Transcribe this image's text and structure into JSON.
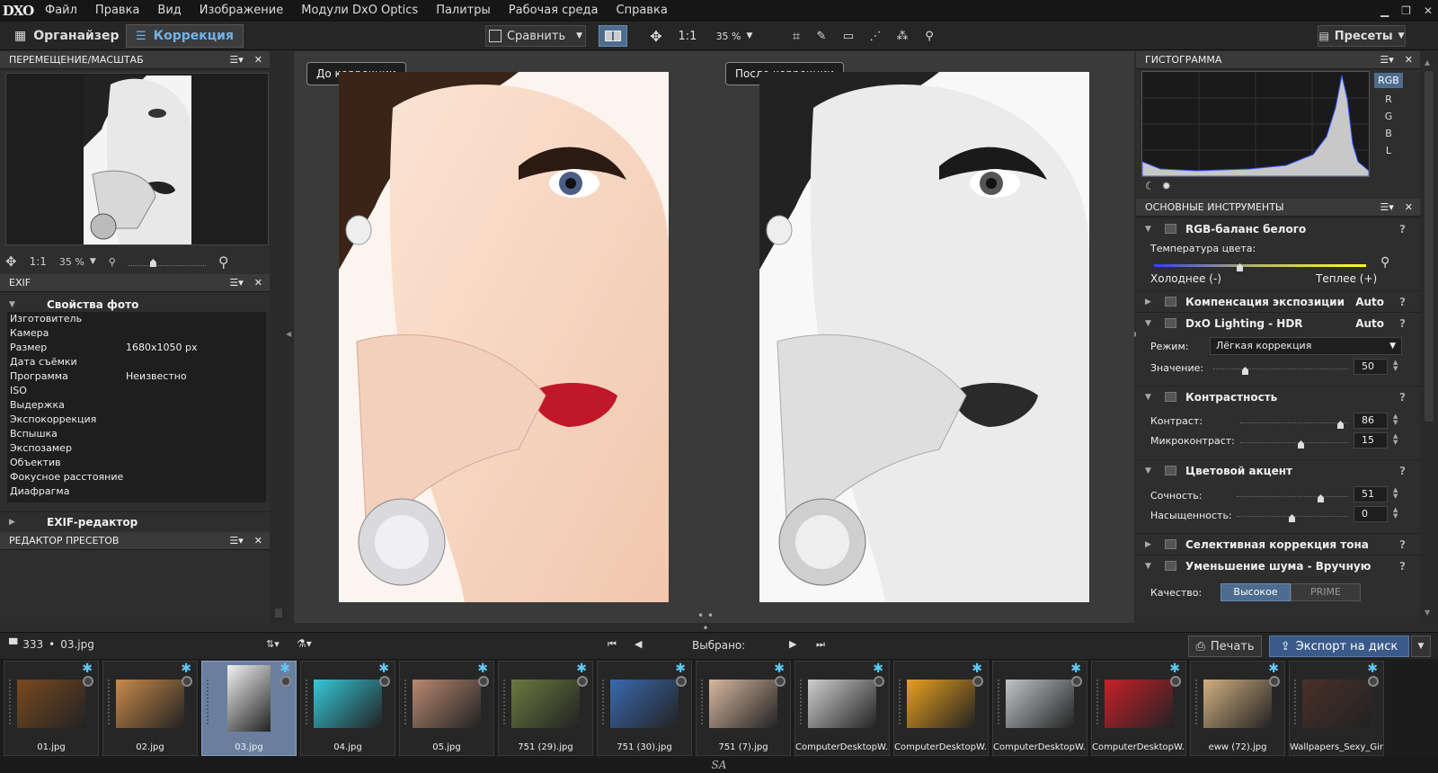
{
  "app": {
    "logo": "DXO"
  },
  "menu": [
    "Файл",
    "Правка",
    "Вид",
    "Изображение",
    "Модули DxO Optics",
    "Палитры",
    "Рабочая среда",
    "Справка"
  ],
  "window_controls": [
    "▁",
    "❐",
    "✕"
  ],
  "toolbar": {
    "organizer": "Органайзер",
    "correction": "Коррекция",
    "compare": "Сравнить",
    "zoom_1_1": "1:1",
    "zoom": "35 %",
    "presets": "Пресеты"
  },
  "left": {
    "nav_title": "ПЕРЕМЕЩЕНИЕ/МАСШТАБ",
    "nav_zoom_1_1": "1:1",
    "nav_zoom": "35 %",
    "exif_title": "EXIF",
    "photo_props": "Свойства фото",
    "exif_rows": [
      {
        "k": "Изготовитель",
        "v": ""
      },
      {
        "k": "Камера",
        "v": ""
      },
      {
        "k": "Размер",
        "v": "1680x1050 px"
      },
      {
        "k": "Дата съёмки",
        "v": ""
      },
      {
        "k": "Программа",
        "v": "Неизвестно"
      },
      {
        "k": "ISO",
        "v": ""
      },
      {
        "k": "Выдержка",
        "v": ""
      },
      {
        "k": "Экспокоррекция",
        "v": ""
      },
      {
        "k": "Вспышка",
        "v": ""
      },
      {
        "k": "Экспозамер",
        "v": ""
      },
      {
        "k": "Объектив",
        "v": ""
      },
      {
        "k": "Фокусное расстояние",
        "v": ""
      },
      {
        "k": "Диафрагма",
        "v": ""
      }
    ],
    "exif_editor": "EXIF-редактор",
    "preset_editor": "РЕДАКТОР ПРЕСЕТОВ"
  },
  "center": {
    "before_label": "До коррекции",
    "after_label": "После коррекции"
  },
  "right": {
    "histogram_title": "ГИСТОГРАММА",
    "channels": [
      "RGB",
      "R",
      "G",
      "B",
      "L"
    ],
    "tools_title": "ОСНОВНЫЕ ИНСТРУМЕНТЫ",
    "wb_title": "RGB-баланс белого",
    "color_temp": "Температура цвета:",
    "colder": "Холоднее (-)",
    "warmer": "Теплее (+)",
    "exposure": "Компенсация экспозиции",
    "exposure_auto": "Auto",
    "lighting": "DxO Lighting - HDR",
    "lighting_auto": "Auto",
    "mode_label": "Режим:",
    "mode_value": "Лёгкая коррекция",
    "value_label": "Значение:",
    "value": "50",
    "contrast_title": "Контрастность",
    "contrast_label": "Контраст:",
    "contrast_value": "86",
    "micro_label": "Микроконтраст:",
    "micro_value": "15",
    "accent_title": "Цветовой акцент",
    "vibrance_label": "Сочность:",
    "vibrance_value": "51",
    "saturation_label": "Насыщенность:",
    "saturation_value": "0",
    "selective": "Селективная коррекция тона",
    "noise": "Уменьшение шума - Вручную",
    "quality_label": "Качество:",
    "quality_high": "Высокое",
    "quality_prime": "PRIME",
    "help": "?"
  },
  "bottom": {
    "folder": "333",
    "file": "03.jpg",
    "selected": "Выбрано:",
    "print": "Печать",
    "export": "Экспорт на диск"
  },
  "film": [
    "01.jpg",
    "02.jpg",
    "03.jpg",
    "04.jpg",
    "05.jpg",
    "751 (29).jpg",
    "751 (30).jpg",
    "751 (7).jpg",
    "ComputerDesktopW...",
    "ComputerDesktopW...",
    "ComputerDesktopW...",
    "ComputerDesktopW...",
    "eww (72).jpg",
    "Wallpapers_Sexy_Girl..."
  ],
  "film_selected_index": 2,
  "statusbar": "SA",
  "colors": {
    "accent": "#6fb3ea",
    "export_bg": "#3a5a8a",
    "star": "#5ec8f5"
  }
}
